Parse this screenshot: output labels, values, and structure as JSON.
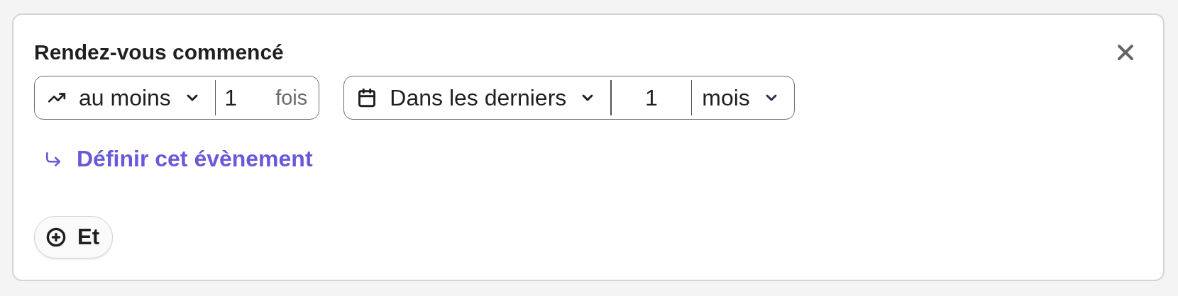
{
  "title": "Rendez-vous commencé",
  "frequency": {
    "operator": "au moins",
    "count": "1",
    "unit": "fois"
  },
  "period": {
    "operator": "Dans les derniers",
    "count": "1",
    "unit": "mois"
  },
  "link": "Définir cet évènement",
  "add_button": "Et"
}
